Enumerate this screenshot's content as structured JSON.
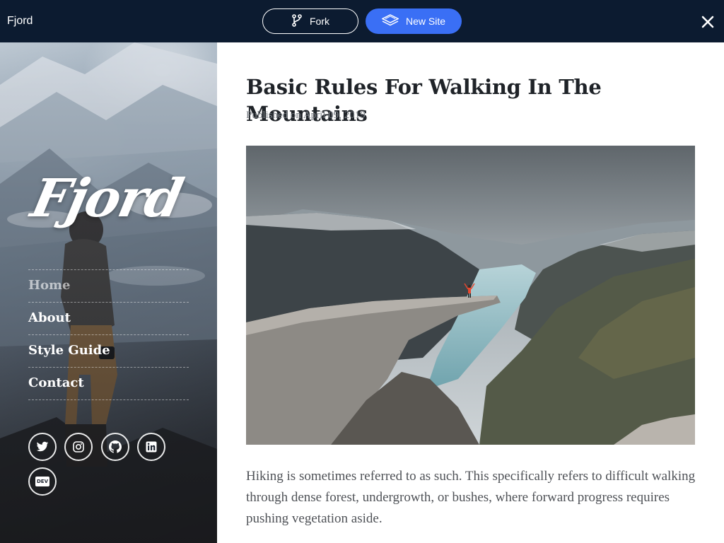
{
  "window": {
    "app_title": "Fjord",
    "fork_label": "Fork",
    "new_site_label": "New Site",
    "accent_color": "#3a6ff5",
    "bar_color": "#0c1b30"
  },
  "sidebar": {
    "logo_text": "Fjord",
    "nav": [
      {
        "label": "Home",
        "active": true
      },
      {
        "label": "About",
        "active": false
      },
      {
        "label": "Style Guide",
        "active": false
      },
      {
        "label": "Contact",
        "active": false
      }
    ],
    "social": [
      {
        "icon": "twitter-icon"
      },
      {
        "icon": "instagram-icon"
      },
      {
        "icon": "github-icon"
      },
      {
        "icon": "linkedin-icon"
      },
      {
        "icon": "dev-icon",
        "text": "DEV"
      }
    ]
  },
  "post": {
    "title": "Basic Rules For Walking In The Mountains",
    "published": "Published on April 09, 2019",
    "body": "Hiking is sometimes referred to as such. This specifically refers to difficult walking through dense forest, undergrowth, or bushes, where forward progress requires pushing vegetation aside."
  }
}
